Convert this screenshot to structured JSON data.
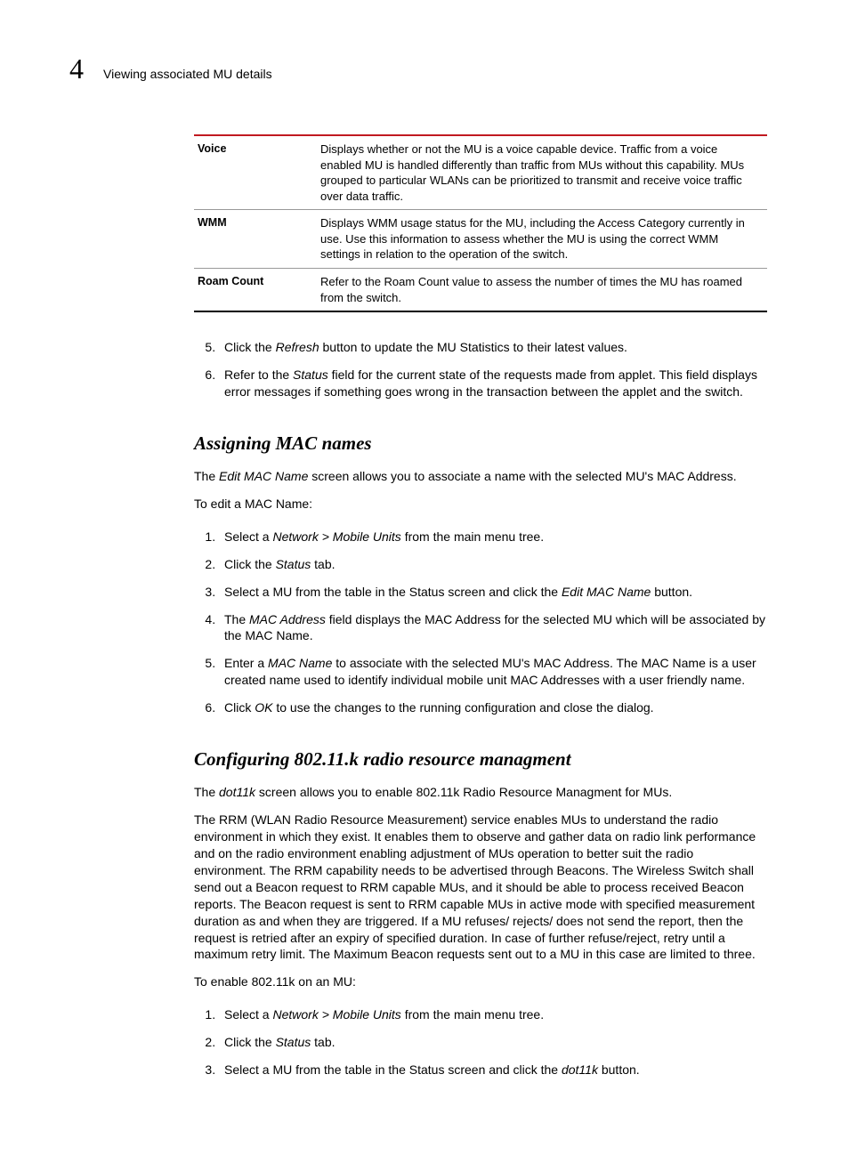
{
  "header": {
    "chapter_number": "4",
    "chapter_title": "Viewing associated MU details"
  },
  "table": {
    "rows": [
      {
        "label": "Voice",
        "desc": "Displays whether or not the MU is a voice capable device. Traffic from a voice enabled MU is handled differently than traffic from MUs without this capability. MUs grouped to particular WLANs can be prioritized to transmit and receive voice traffic over data traffic."
      },
      {
        "label": "WMM",
        "desc": "Displays WMM usage status for the MU, including the Access Category currently in use. Use this information to assess whether the MU is using the correct WMM settings in relation to the operation of the switch."
      },
      {
        "label": "Roam Count",
        "desc": "Refer to the Roam Count value to assess the number of times the MU has roamed from the switch."
      }
    ]
  },
  "list_a": {
    "start": 5,
    "items": [
      {
        "pre": "Click the ",
        "em": "Refresh",
        "post": " button to update the MU Statistics to their latest values."
      },
      {
        "pre": "Refer to the ",
        "em": "Status",
        "post": " field for the current state of the requests made from applet. This field displays error messages if something goes wrong in the transaction between the applet and the switch."
      }
    ]
  },
  "sec1": {
    "heading": "Assigning MAC names",
    "p1": {
      "pre": "The ",
      "em": "Edit MAC Name",
      "post": " screen allows you to associate a name with the selected MU's MAC Address."
    },
    "p2": "To edit a MAC Name:",
    "list": [
      {
        "pre": "Select a ",
        "em": "Network > Mobile Units",
        "post": " from the main menu tree."
      },
      {
        "pre": "Click the ",
        "em": "Status",
        "post": " tab."
      },
      {
        "pre": "Select a MU from the table in the Status screen and click the ",
        "em": "Edit MAC Name",
        "post": " button."
      },
      {
        "pre": "The ",
        "em": "MAC Address",
        "post": " field displays the MAC Address for the selected MU which will be associated by the MAC Name."
      },
      {
        "pre": "Enter a ",
        "em": "MAC Name",
        "post": " to associate with the selected MU's MAC Address. The MAC Name is a user created name used to identify individual mobile unit MAC Addresses with a user friendly name."
      },
      {
        "pre": "Click ",
        "em": "OK",
        "post": " to use the changes to the running configuration and close the dialog."
      }
    ]
  },
  "sec2": {
    "heading": "Configuring 802.11.k radio resource managment",
    "p1": {
      "pre": "The ",
      "em": "dot11k",
      "post": " screen allows you to enable 802.11k Radio Resource Managment for MUs."
    },
    "p2": "The RRM (WLAN Radio Resource Measurement) service enables MUs to understand the radio environment in which they exist. It enables them to observe and gather data on radio link performance and on the radio environment enabling adjustment of MUs operation to better suit the radio environment. The RRM capability needs to be advertised through Beacons. The Wireless Switch shall send out a Beacon request to RRM capable MUs, and it should be able to process received Beacon reports. The Beacon request is sent to RRM capable MUs in active mode with specified measurement duration as and when they are triggered. If a MU refuses/ rejects/ does not send the report, then the request is retried after an expiry of specified duration. In case of further refuse/reject, retry until a maximum retry limit. The Maximum Beacon requests sent out to a MU in this case are limited to three.",
    "p3": "To enable 802.11k on an MU:",
    "list": [
      {
        "pre": "Select a ",
        "em": "Network > Mobile Units",
        "post": " from the main menu tree."
      },
      {
        "pre": "Click the ",
        "em": "Status",
        "post": " tab."
      },
      {
        "pre": "Select a MU from the table in the Status screen and click the ",
        "em": "dot11k",
        "post": " button."
      }
    ]
  }
}
